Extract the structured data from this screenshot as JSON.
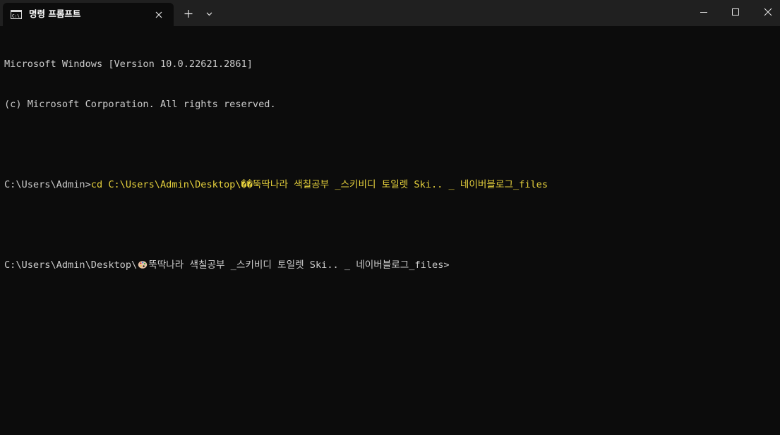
{
  "titlebar": {
    "tab_title": "명령 프롬프트",
    "tab_icon": "cmd-console-icon",
    "close_icon": "close-icon",
    "new_tab_icon": "plus-icon",
    "dropdown_icon": "chevron-down-icon"
  },
  "window_controls": {
    "minimize_icon": "minimize-icon",
    "maximize_icon": "maximize-icon",
    "close_icon": "close-icon"
  },
  "console": {
    "line1": "Microsoft Windows [Version 10.0.22621.2861]",
    "line2": "(c) Microsoft Corporation. All rights reserved.",
    "line4_prompt": "C:\\Users\\Admin>",
    "line4_command": "cd C:\\Users\\Admin\\Desktop\\��뚝딱나라 색칠공부 _스키비디 토일렛 Ski.. _ 네이버블로그_files",
    "line6_prefix": "C:\\Users\\Admin\\Desktop\\",
    "line6_emoji": "palette-emoji-icon",
    "line6_suffix": "뚝딱나라 색칠공부 _스키비디 토일렛 Ski.. _ 네이버블로그_files>"
  },
  "colors": {
    "background": "#0c0c0c",
    "titlebar": "#202020",
    "text": "#cccccc",
    "command_text": "#e5d03c"
  }
}
